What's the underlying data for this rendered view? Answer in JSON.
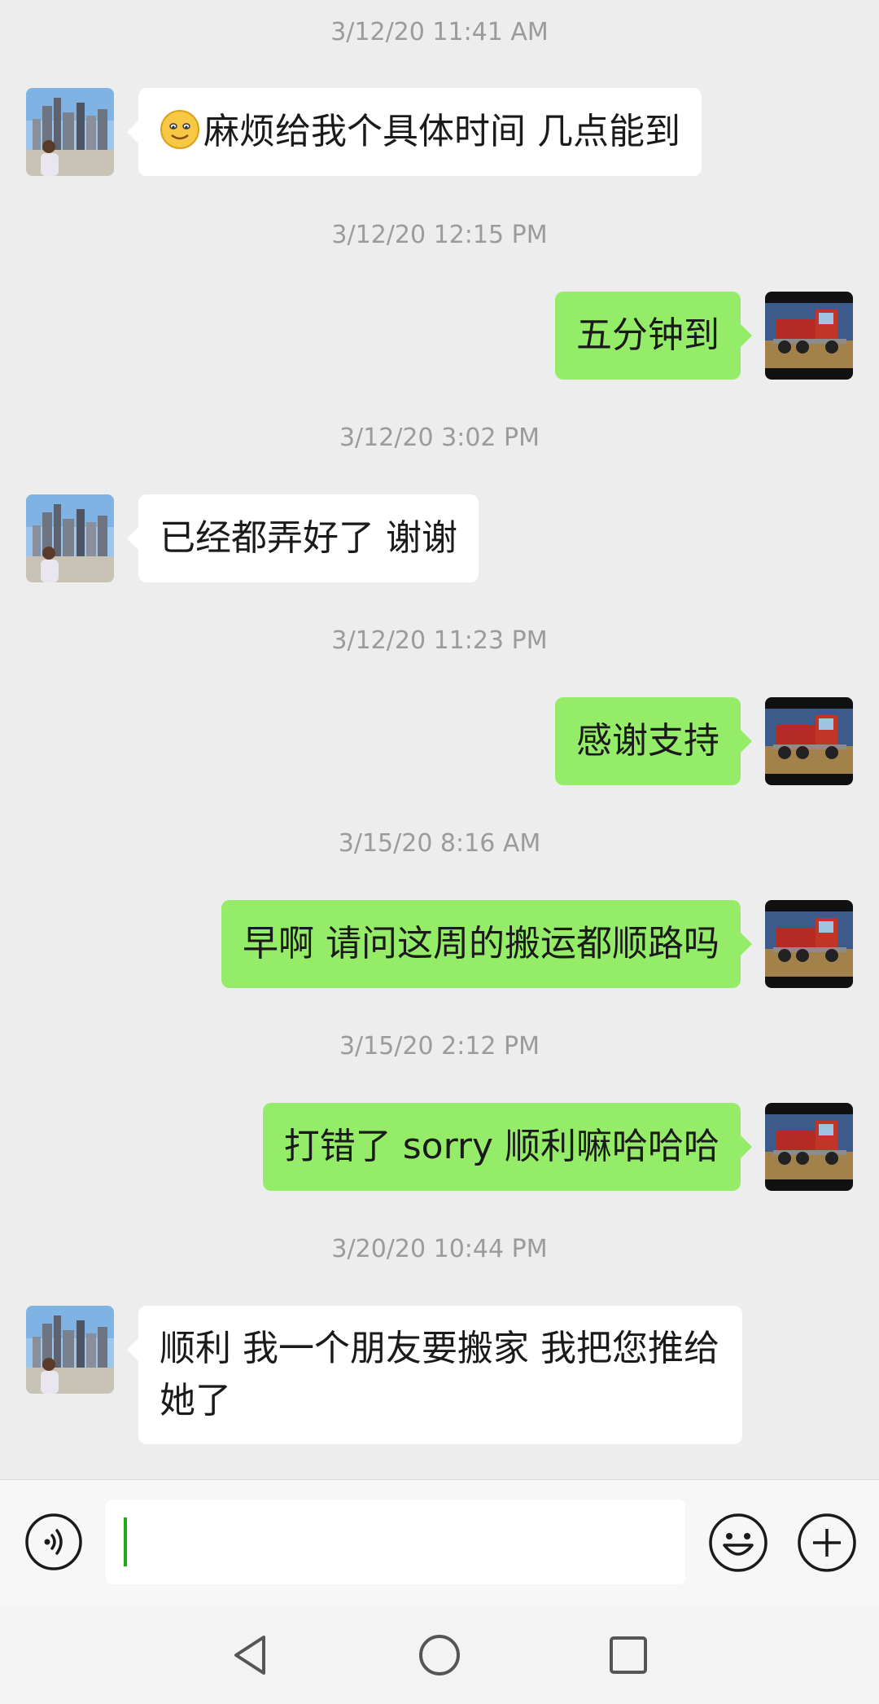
{
  "messages": [
    {
      "time": "3/12/20 11:41 AM",
      "side": "in",
      "text": "麻烦给我个具体时间 几点能到",
      "emoji": "smiling-face"
    },
    {
      "time": "3/12/20 12:15 PM",
      "side": "out",
      "text": "五分钟到"
    },
    {
      "time": "3/12/20 3:02 PM",
      "side": "in",
      "text": "已经都弄好了 谢谢"
    },
    {
      "time": "3/12/20 11:23 PM",
      "side": "out",
      "text": "感谢支持"
    },
    {
      "time": "3/15/20 8:16 AM",
      "side": "out",
      "text": "早啊 请问这周的搬运都顺路吗"
    },
    {
      "time": "3/15/20 2:12 PM",
      "side": "out",
      "text": "打错了 sorry 顺利嘛哈哈哈"
    },
    {
      "time": "3/20/20 10:44 PM",
      "side": "in",
      "text": "顺利 我一个朋友要搬家 我把您推给她了"
    }
  ],
  "input": {
    "value": ""
  },
  "icons": {
    "voice": "voice-icon",
    "emoji": "emoji-icon",
    "more": "plus-icon",
    "nav_back": "back-triangle-icon",
    "nav_home": "home-circle-icon",
    "nav_recent": "recent-square-icon"
  },
  "colors": {
    "background": "#ededed",
    "incoming_bubble": "#ffffff",
    "outgoing_bubble": "#95ec69",
    "timestamp": "#9b9b9b",
    "caret": "#1aad19"
  }
}
